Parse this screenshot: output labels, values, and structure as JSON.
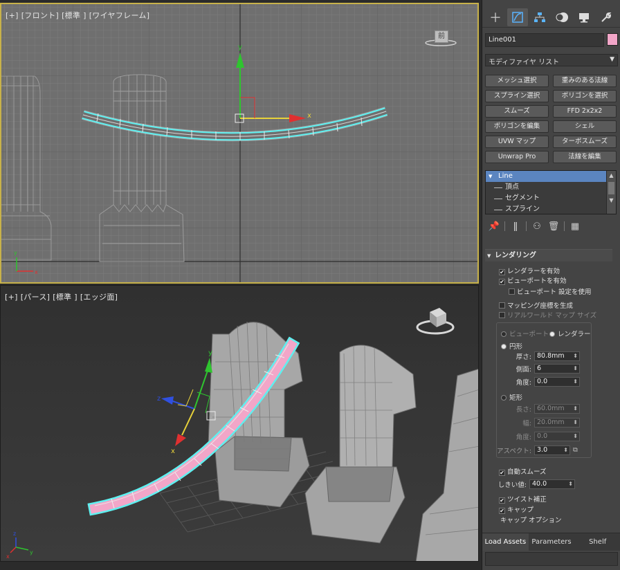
{
  "viewports": {
    "front": {
      "label_parts": [
        "[+]",
        "[フロント]",
        "[標準 ]",
        "[ワイヤフレーム]"
      ],
      "viewcube_label": "前",
      "gizmo": {
        "x_label": "x",
        "y_label": "y"
      }
    },
    "perspective": {
      "label_parts": [
        "[+]",
        "[パース]",
        "[標準 ]",
        "[エッジ面]"
      ],
      "gizmo": {
        "x_label": "x",
        "y_label": "y",
        "z_label": "z"
      },
      "axis_tripod": {
        "x_label": "x",
        "y_label": "y",
        "z_label": "z"
      }
    },
    "front_axis_tripod": {
      "x_label": "x",
      "y_label": "y"
    }
  },
  "panel": {
    "tabs": [
      {
        "name": "create",
        "icon": "plus-icon"
      },
      {
        "name": "modify",
        "icon": "modify-icon",
        "active": true
      },
      {
        "name": "hierarchy",
        "icon": "hierarchy-icon"
      },
      {
        "name": "motion",
        "icon": "motion-icon"
      },
      {
        "name": "display",
        "icon": "display-icon"
      },
      {
        "name": "utilities",
        "icon": "wrench-icon"
      }
    ],
    "object_name": "Line001",
    "object_color": "#f2a6c8",
    "modifier_list": "モディファイヤ リスト",
    "modifier_buttons": [
      "メッシュ選択",
      "重みのある法線",
      "スプライン選択",
      "ポリゴンを選択",
      "スムーズ",
      "FFD 2x2x2",
      "ポリゴンを編集",
      "シェル",
      "UVW マップ",
      "ターボスムーズ",
      "Unwrap Pro",
      "法線を編集"
    ],
    "stack": {
      "selected": "Line",
      "sub_items": [
        "頂点",
        "セグメント",
        "スプライン"
      ]
    },
    "rendering": {
      "title": "レンダリング",
      "enable_renderer": "レンダラーを有効",
      "enable_viewport": "ビューポートを有効",
      "use_viewport_settings": "ビューポート 設定を使用",
      "generate_mapping": "マッピング座標を生成",
      "real_world_map": "リアルワールド マップ サイズ",
      "viewport_radio": "ビューポート",
      "renderer_radio": "レンダラー",
      "radial": "円形",
      "thickness_label": "厚さ:",
      "thickness_value": "80.8mm",
      "sides_label": "側面:",
      "sides_value": "6",
      "angle_label": "角度:",
      "angle_value": "0.0",
      "rectangular": "矩形",
      "length_label": "長さ:",
      "length_value": "60.0mm",
      "width_label": "幅:",
      "width_value": "20.0mm",
      "rect_angle_label": "角度:",
      "rect_angle_value": "0.0",
      "aspect_label": "アスペクト:",
      "aspect_value": "3.0",
      "auto_smooth": "自動スムーズ",
      "threshold_label": "しきい値:",
      "threshold_value": "40.0",
      "twist_correct": "ツイスト補正",
      "cap": "キャップ",
      "cap_options": "キャップ オプション"
    },
    "bottom_tabs": [
      "Load Assets",
      "Parameters",
      "Shelf"
    ]
  },
  "colors": {
    "selection_cyan": "#5ff0f0",
    "spline_pink": "#f2a6c8",
    "active_viewport_border": "#c8b24a"
  }
}
